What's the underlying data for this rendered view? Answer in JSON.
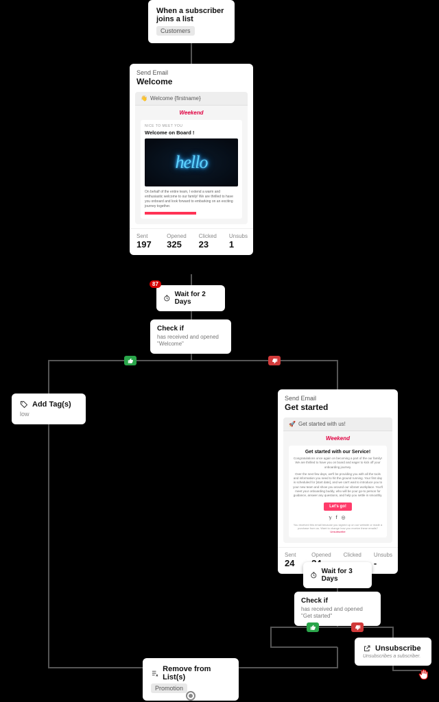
{
  "trigger": {
    "title": "When a subscriber joins a list",
    "list_pill": "Customers"
  },
  "email1": {
    "type": "Send Email",
    "title": "Welcome",
    "subject_emoji": "👋",
    "subject": "Welcome {firstname}",
    "brand": "Weekend",
    "preview_eyebrow": "NICE TO MEET YOU",
    "preview_heading": "Welcome on Board !",
    "hello_word": "hello",
    "preview_para": "On behalf of the entire team, I extend a warm and enthusiastic welcome to our family! We are thrilled to have you onboard and look forward to embarking on an exciting journey together.",
    "stats": {
      "sent_k": "Sent",
      "sent_v": "197",
      "opened_k": "Opened",
      "opened_v": "325",
      "clicked_k": "Clicked",
      "clicked_v": "23",
      "unsubs_k": "Unsubs",
      "unsubs_v": "1"
    }
  },
  "wait1": {
    "badge": "87",
    "text": "Wait for 2 Days"
  },
  "check1": {
    "title": "Check if",
    "desc": "has received and opened \"Welcome\""
  },
  "addtag": {
    "title": "Add Tag(s)",
    "tag": "low"
  },
  "email2": {
    "type": "Send Email",
    "title": "Get started",
    "subject_emoji": "🚀",
    "subject": "Get started with us!",
    "brand": "Weekend",
    "heading": "Get started with our Service!",
    "para1": "Congratulations once again on becoming a part of the our family! We are thrilled to have you on board and eager to kick off your onboarding journey.",
    "para2": "Over the next few days, we'll be providing you with all the tools and information you need to hit the ground running. Your first day is scheduled for [start date], and we can't wait to introduce you to your new team and show you around our vibrant workplace. You'll meet your onboarding buddy, who will be your go-to person for guidance, answer any questions, and help you settle in smoothly.",
    "cta": "Let's go!",
    "footer": "You received this email because you signed up on our website or made a purchase from us. Want to change how you receive these emails?",
    "stats": {
      "sent_k": "Sent",
      "sent_v": "24",
      "opened_k": "Opened",
      "opened_v": "24",
      "clicked_k": "Clicked",
      "clicked_v": "-",
      "unsubs_k": "Unsubs",
      "unsubs_v": "-"
    }
  },
  "wait2": {
    "text": "Wait for 3 Days"
  },
  "check2": {
    "title": "Check if",
    "desc": "has received and opened \"Get started\""
  },
  "unsub": {
    "title": "Unsubscribe",
    "desc": "Unsubscribes a subscriber."
  },
  "remove": {
    "title": "Remove from List(s)",
    "list": "Promotion"
  }
}
